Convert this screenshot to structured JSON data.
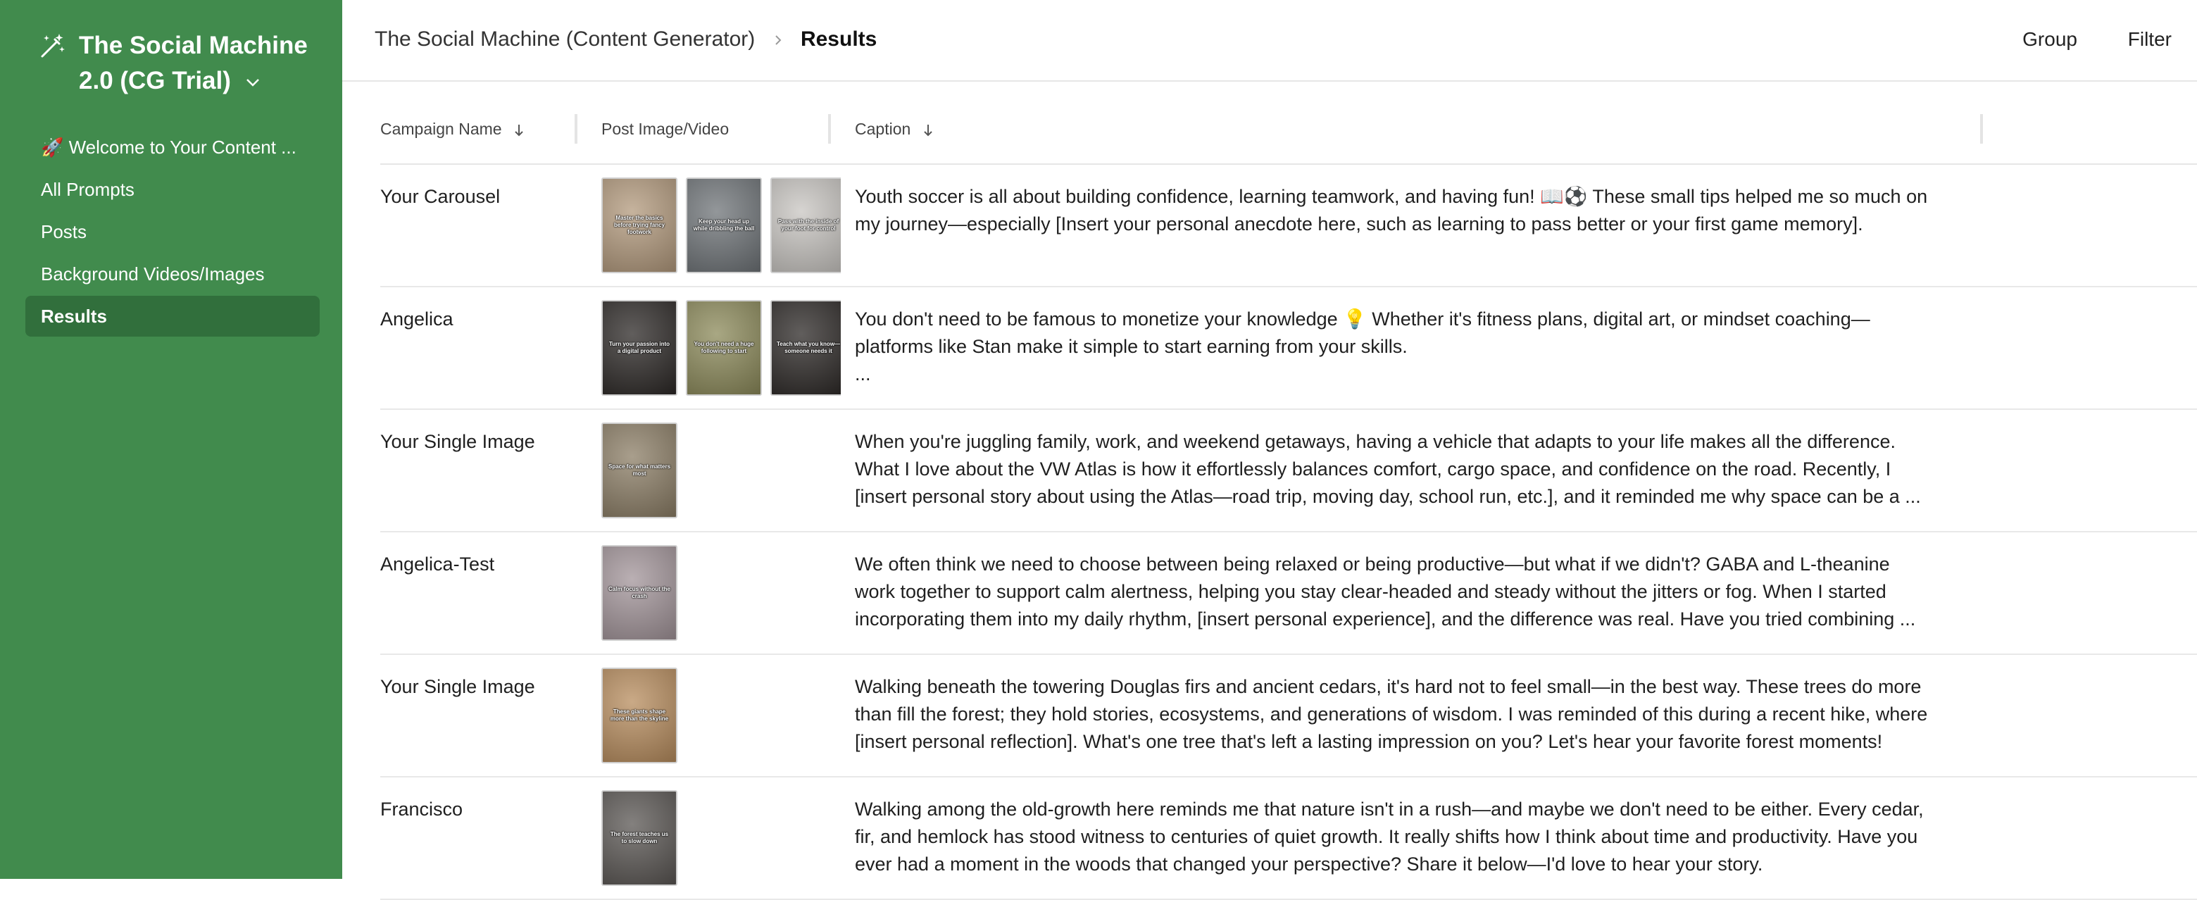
{
  "app": {
    "title_line1": "The Social Machine",
    "title_line2": "2.0 (CG Trial)",
    "icon": "magic-wand-icon"
  },
  "sidebar": {
    "items": [
      {
        "label": "🚀 Welcome to Your Content ..."
      },
      {
        "label": "All Prompts"
      },
      {
        "label": "Posts"
      },
      {
        "label": "Background Videos/Images"
      },
      {
        "label": "Results"
      }
    ],
    "active_index": 4
  },
  "breadcrumb": {
    "parent": "The Social Machine (Content Generator)",
    "current": "Results"
  },
  "toolbar": {
    "group_label": "Group",
    "filter_label": "Filter"
  },
  "table": {
    "columns": [
      "Campaign Name",
      "Post Image/Video",
      "Caption"
    ],
    "rows": [
      {
        "name": "Your Carousel",
        "thumbs": [
          {
            "text": "Master the basics before trying fancy footwork",
            "color": "#b39a7d"
          },
          {
            "text": "Keep your head up while dribbling the ball",
            "color": "#6f7478"
          },
          {
            "text": "Pass with the inside of your foot for control",
            "color": "#c9c6c2"
          }
        ],
        "caption": [
          "Youth soccer is all about building confidence, learning teamwork, and having fun! 📖⚽ These small tips helped me so much on",
          "my journey—especially [Insert your personal anecdote here, such as learning to pass better or your first game memory]."
        ]
      },
      {
        "name": "Angelica",
        "thumbs": [
          {
            "text": "Turn your passion into a digital product",
            "color": "#2c2826"
          },
          {
            "text": "You don't need a huge following to start",
            "color": "#8c8a5a"
          },
          {
            "text": "Teach what you know—someone needs it",
            "color": "#2c2826"
          }
        ],
        "caption": [
          "You don't need to be famous to monetize your knowledge 💡 Whether it's fitness plans, digital art, or mindset coaching—",
          "platforms like Stan make it simple to start earning from your skills.",
          "..."
        ]
      },
      {
        "name": "Your Single Image",
        "thumbs": [
          {
            "text": "Space for what matters most",
            "color": "#8c7e66"
          }
        ],
        "caption": [
          "When you're juggling family, work, and weekend getaways, having a vehicle that adapts to your life makes all the difference.",
          "What I love about the VW Atlas is how it effortlessly balances comfort, cargo space, and confidence on the road. Recently, I",
          "[insert personal story about using the Atlas—road trip, moving day, school run, etc.], and it reminded me why space can be a ..."
        ]
      },
      {
        "name": "Angelica-Test",
        "thumbs": [
          {
            "text": "Calm focus without the crash",
            "color": "#a3959a"
          }
        ],
        "caption": [
          "We often think we need to choose between being relaxed or being productive—but what if we didn't? GABA and L-theanine",
          "work together to support calm alertness, helping you stay clear-headed and steady without the jitters or fog. When I started",
          "incorporating them into my daily rhythm, [insert personal experience], and the difference was real. Have you tried combining ..."
        ]
      },
      {
        "name": "Your Single Image",
        "thumbs": [
          {
            "text": "These giants shape more than the skyline",
            "color": "#b88d5e"
          }
        ],
        "caption": [
          "Walking beneath the towering Douglas firs and ancient cedars, it's hard not to feel small—in the best way. These trees do more",
          "than fill the forest; they hold stories, ecosystems, and generations of wisdom. I was reminded of this during a recent hike, where",
          "[insert personal reflection]. What's one tree that's left a lasting impression on you? Let's hear your favorite forest moments!"
        ]
      },
      {
        "name": "Francisco",
        "thumbs": [
          {
            "text": "The forest teaches us to slow down",
            "color": "#5a5653"
          }
        ],
        "caption": [
          "Walking among the old-growth here reminds me that nature isn't in a rush—and maybe we don't need to be either. Every cedar,",
          "fir, and hemlock has stood witness to centuries of quiet growth. It really shifts how I think about time and productivity. Have you",
          "ever had a moment in the woods that changed your perspective? Share it below—I'd love to hear your story."
        ]
      }
    ]
  },
  "colors": {
    "sidebar_bg": "#418b4d",
    "sidebar_active": "#316f3c"
  }
}
